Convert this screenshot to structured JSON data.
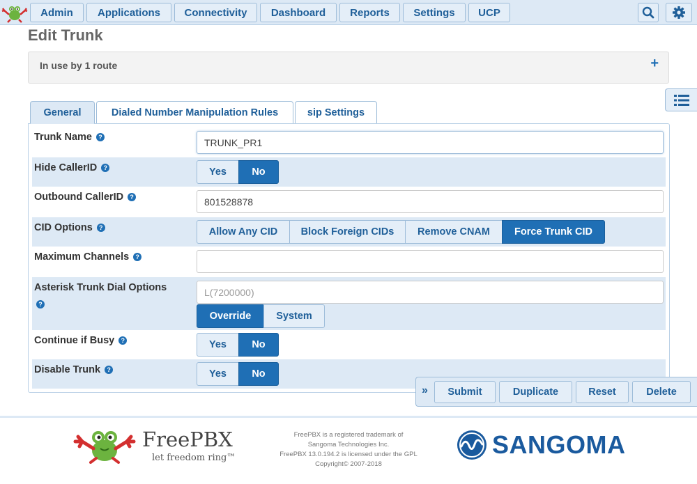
{
  "nav": {
    "items": [
      "Admin",
      "Applications",
      "Connectivity",
      "Dashboard",
      "Reports",
      "Settings",
      "UCP"
    ]
  },
  "page": {
    "title": "Edit Trunk",
    "in_use": "In use by 1 route",
    "expand_symbol": "+"
  },
  "tabs": [
    "General",
    "Dialed Number Manipulation Rules",
    "sip Settings"
  ],
  "form": {
    "trunk_name": {
      "label": "Trunk Name",
      "value": "TRUNK_PR1"
    },
    "hide_callerid": {
      "label": "Hide CallerID",
      "options": [
        "Yes",
        "No"
      ],
      "selected": "No"
    },
    "outbound_callerid": {
      "label": "Outbound CallerID",
      "value": "801528878"
    },
    "cid_options": {
      "label": "CID Options",
      "options": [
        "Allow Any CID",
        "Block Foreign CIDs",
        "Remove CNAM",
        "Force Trunk CID"
      ],
      "selected": "Force Trunk CID"
    },
    "max_channels": {
      "label": "Maximum Channels",
      "value": ""
    },
    "dial_options": {
      "label": "Asterisk Trunk Dial Options",
      "placeholder": "L(7200000)",
      "options": [
        "Override",
        "System"
      ],
      "selected": "Override"
    },
    "continue_busy": {
      "label": "Continue if Busy",
      "options": [
        "Yes",
        "No"
      ],
      "selected": "No"
    },
    "disable_trunk": {
      "label": "Disable Trunk",
      "options": [
        "Yes",
        "No"
      ],
      "selected": "No"
    }
  },
  "actions": {
    "arrow": "»",
    "submit": "Submit",
    "duplicate": "Duplicate",
    "reset": "Reset",
    "delete": "Delete"
  },
  "footer": {
    "freepbx_name": "FreePBX",
    "freepbx_tagline": "let freedom ring™",
    "legal_lines": [
      "FreePBX is a registered trademark of",
      "Sangoma Technologies Inc.",
      "FreePBX 13.0.194.2 is licensed under the GPL",
      "Copyright© 2007-2018"
    ],
    "sangoma_name": "SANGOMA"
  },
  "colors": {
    "accent": "#1f6fb5",
    "nav_bg": "#dde9f5",
    "button_text": "#1f5f99",
    "sangoma_blue": "#1a5a9e"
  },
  "icons": [
    "freepbx-frog-icon",
    "search-icon",
    "gear-icon",
    "list-icon",
    "help-icon",
    "plus-icon",
    "double-chevron-icon",
    "sangoma-logo-icon"
  ]
}
